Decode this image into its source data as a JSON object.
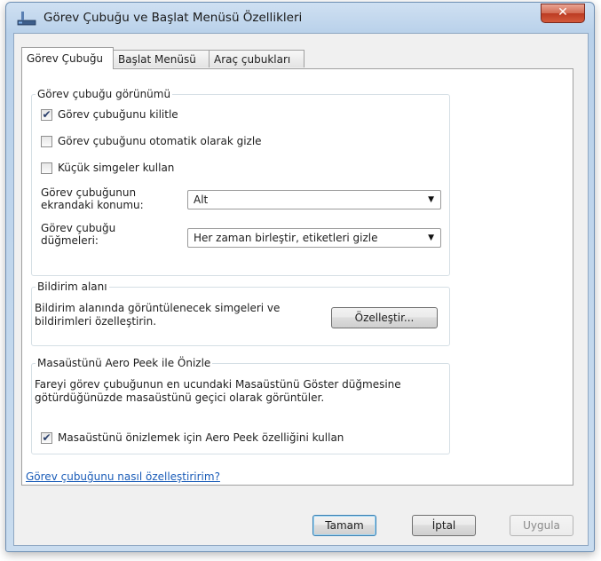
{
  "window": {
    "title": "Görev Çubuğu ve Başlat Menüsü Özellikleri",
    "close_label": "✕"
  },
  "tabs": [
    {
      "label": "Görev Çubuğu",
      "active": true
    },
    {
      "label": "Başlat Menüsü",
      "active": false
    },
    {
      "label": "Araç çubukları",
      "active": false
    }
  ],
  "appearance": {
    "legend": "Görev çubuğu görünümü",
    "lock": {
      "label": "Görev çubuğunu kilitle",
      "checked": "✔"
    },
    "autohide": {
      "label": "Görev çubuğunu otomatik olarak gizle",
      "checked": ""
    },
    "small_icons": {
      "label": "Küçük simgeler kullan",
      "checked": ""
    },
    "location": {
      "label_line1": "Görev çubuğunun",
      "label_line2": "ekrandaki konumu:",
      "value": "Alt"
    },
    "buttons": {
      "label_line1": "Görev çubuğu",
      "label_line2": "düğmeleri:",
      "value": "Her zaman birleştir, etiketleri gizle"
    }
  },
  "notification": {
    "legend": "Bildirim alanı",
    "text_line1": "Bildirim alanında görüntülenecek simgeleri ve",
    "text_line2": "bildirimleri özelleştirin.",
    "customize_button": "Özelleştir..."
  },
  "aero_peek": {
    "legend": "Masaüstünü Aero Peek ile Önizle",
    "text_line1": "Fareyi görev çubuğunun en ucundaki Masaüstünü Göster düğmesine",
    "text_line2": "götürdüğünüzde masaüstünü geçici olarak görüntüler.",
    "checkbox": {
      "label": "Masaüstünü önizlemek için Aero Peek özelliğini kullan",
      "checked": "✔"
    }
  },
  "help_link": "Görev çubuğunu nasıl özelleştiririm?",
  "footer": {
    "ok": "Tamam",
    "cancel": "İptal",
    "apply": "Uygula"
  }
}
